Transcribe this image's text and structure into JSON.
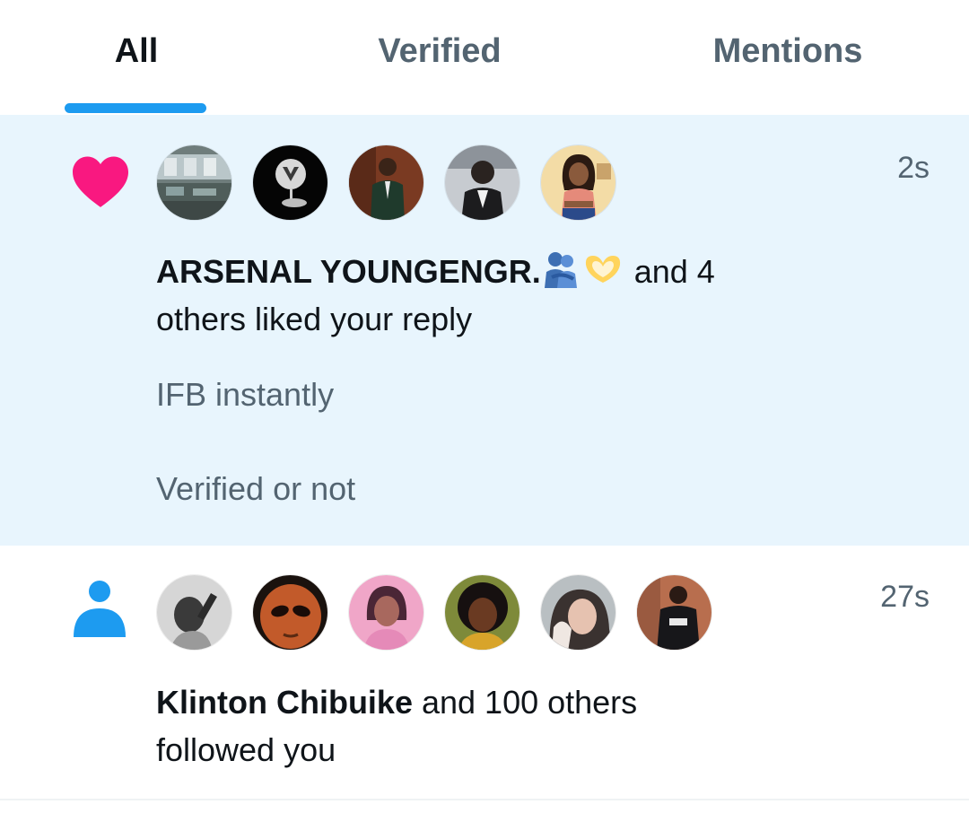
{
  "tabs": [
    {
      "label": "All",
      "active": true
    },
    {
      "label": "Verified",
      "active": false
    },
    {
      "label": "Mentions",
      "active": false
    }
  ],
  "notifications": [
    {
      "type_icon": "heart-icon",
      "icon_color": "#f91880",
      "timestamp": "2s",
      "actor_name": "ARSENAL YOUNGENGR.",
      "actor_emojis": [
        "people-hugging-emoji",
        "heart-hands-emoji"
      ],
      "action_text": "and 4 others liked your reply",
      "action_line1": " and 4",
      "action_line2": "others liked your reply",
      "snippet": [
        "IFB instantly",
        "Verified or not"
      ],
      "avatars": [
        "avatar-1",
        "avatar-2",
        "avatar-3",
        "avatar-4",
        "avatar-5"
      ]
    },
    {
      "type_icon": "person-icon",
      "icon_color": "#1d9bf0",
      "timestamp": "27s",
      "actor_name": "Klinton Chibuike",
      "action_line1": " and 100 others",
      "action_line2": "followed you",
      "avatars": [
        "avatar-1",
        "avatar-2",
        "avatar-3",
        "avatar-4",
        "avatar-5",
        "avatar-6"
      ]
    }
  ],
  "colors": {
    "accent": "#1d9bf0",
    "highlight_bg": "#e8f5fd",
    "secondary_text": "#536471"
  }
}
